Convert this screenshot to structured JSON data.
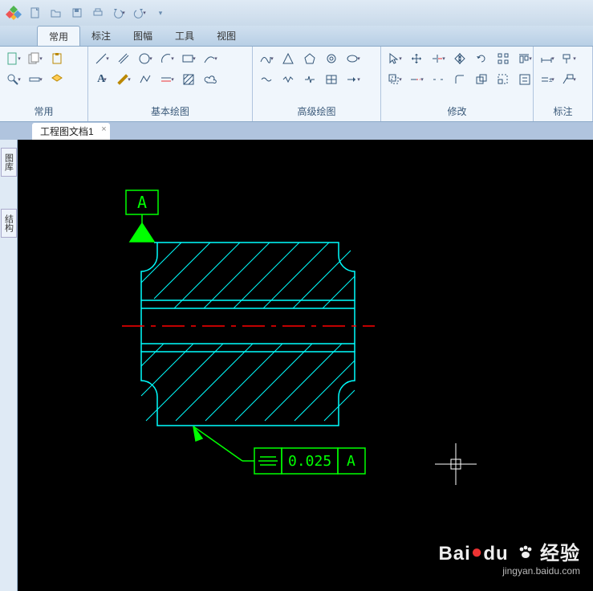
{
  "qat": {
    "items": [
      "new",
      "open",
      "save",
      "print",
      "undo",
      "redo"
    ]
  },
  "menu": {
    "items": [
      "常用",
      "标注",
      "图幅",
      "工具",
      "视图"
    ],
    "active": 0
  },
  "ribbon_groups": [
    {
      "label": "常用"
    },
    {
      "label": "基本绘图"
    },
    {
      "label": "高级绘图"
    },
    {
      "label": "修改"
    },
    {
      "label": "标注"
    }
  ],
  "document_tab": {
    "name": "工程图文档1",
    "close": "×"
  },
  "side_tabs": [
    "图库",
    "结构"
  ],
  "drawing": {
    "datum_label": "A",
    "fcf_tolerance": "0.025",
    "fcf_datum": "A"
  },
  "watermark": {
    "main_a": "Bai",
    "main_b": "du",
    "main_c": "经验",
    "sub": "jingyan.baidu.com"
  }
}
